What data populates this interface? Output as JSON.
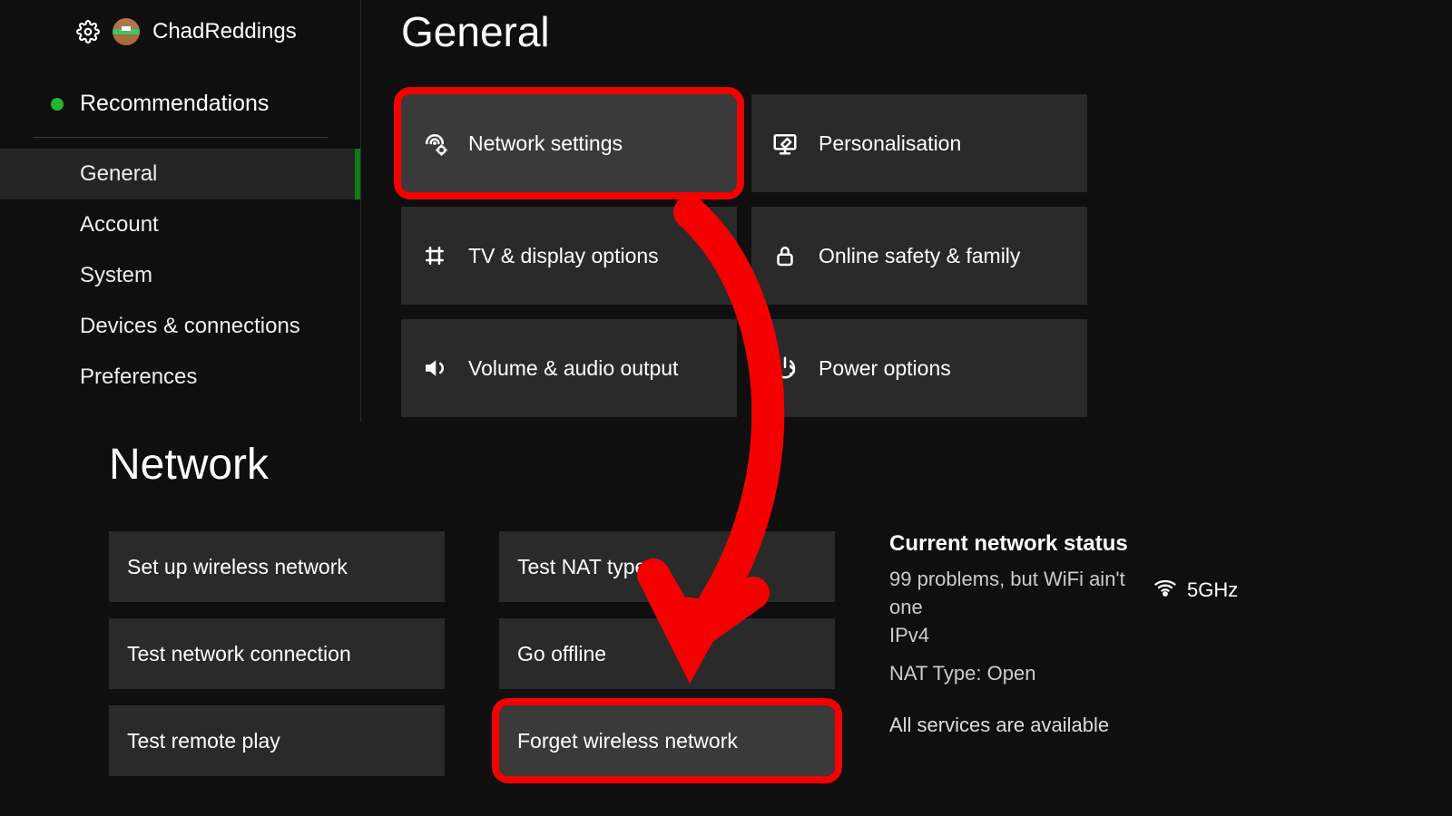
{
  "sidebar": {
    "username": "ChadReddings",
    "recommendations": "Recommendations",
    "items": [
      {
        "label": "General",
        "selected": true
      },
      {
        "label": "Account"
      },
      {
        "label": "System"
      },
      {
        "label": "Devices & connections"
      },
      {
        "label": "Preferences"
      }
    ]
  },
  "general": {
    "title": "General",
    "tiles": [
      {
        "label": "Network settings",
        "icon": "network-settings-icon",
        "highlight": true,
        "annotated": true
      },
      {
        "label": "Personalisation",
        "icon": "personalisation-icon"
      },
      {
        "label": "TV & display options",
        "icon": "tv-display-icon"
      },
      {
        "label": "Online safety & family",
        "icon": "lock-icon"
      },
      {
        "label": "Volume & audio output",
        "icon": "volume-icon"
      },
      {
        "label": "Power options",
        "icon": "power-icon"
      }
    ]
  },
  "network": {
    "title": "Network",
    "col1": [
      {
        "label": "Set up wireless network"
      },
      {
        "label": "Test network connection"
      },
      {
        "label": "Test remote play"
      }
    ],
    "col2": [
      {
        "label": "Test NAT type"
      },
      {
        "label": "Go offline"
      },
      {
        "label": "Forget wireless network",
        "highlight": true,
        "annotated": true
      }
    ],
    "status": {
      "title": "Current network status",
      "ssid": "99 problems, but WiFi ain't one",
      "ip": "IPv4",
      "nat": "NAT Type: Open",
      "band": "5GHz",
      "services": "All services are available"
    }
  }
}
